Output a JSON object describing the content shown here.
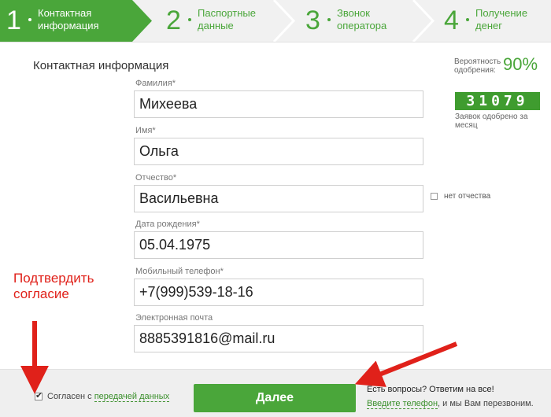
{
  "steps": [
    {
      "num": "1",
      "label_line1": "Контактная",
      "label_line2": "информация",
      "active": true
    },
    {
      "num": "2",
      "label_line1": "Паспортные",
      "label_line2": "данные",
      "active": false
    },
    {
      "num": "3",
      "label_line1": "Звонок",
      "label_line2": "оператора",
      "active": false
    },
    {
      "num": "4",
      "label_line1": "Получение",
      "label_line2": "денег",
      "active": false
    }
  ],
  "section_title": "Контактная информация",
  "approval": {
    "label_line1": "Вероятность",
    "label_line2": "одобрения:",
    "value": "90%",
    "counter": "31079",
    "counter_label": "Заявок одобрено за месяц"
  },
  "fields": {
    "last_name": {
      "label": "Фамилия*",
      "value": "Михеева"
    },
    "first_name": {
      "label": "Имя*",
      "value": "Ольга"
    },
    "patronymic": {
      "label": "Отчество*",
      "value": "Васильевна"
    },
    "birth_date": {
      "label": "Дата рождения*",
      "value": "05.04.1975"
    },
    "phone": {
      "label": "Мобильный телефон*",
      "value": "+7(999)539-18-16"
    },
    "email": {
      "label": "Электронная почта",
      "value": "8885391816@mail.ru"
    }
  },
  "no_patronymic_label": "нет отчества",
  "annotation": {
    "line1": "Подтвердить",
    "line2": "согласие"
  },
  "footer": {
    "consent_text": "Согласен с",
    "consent_link": "передачей данных",
    "consent_checked": true,
    "next_button": "Далее",
    "questions": "Есть вопросы? Ответим на все!",
    "callback_link": "Введите телефон",
    "callback_text": ", и мы Вам перезвоним."
  },
  "colors": {
    "accent": "#4aa63a",
    "annotation": "#e0211a"
  }
}
